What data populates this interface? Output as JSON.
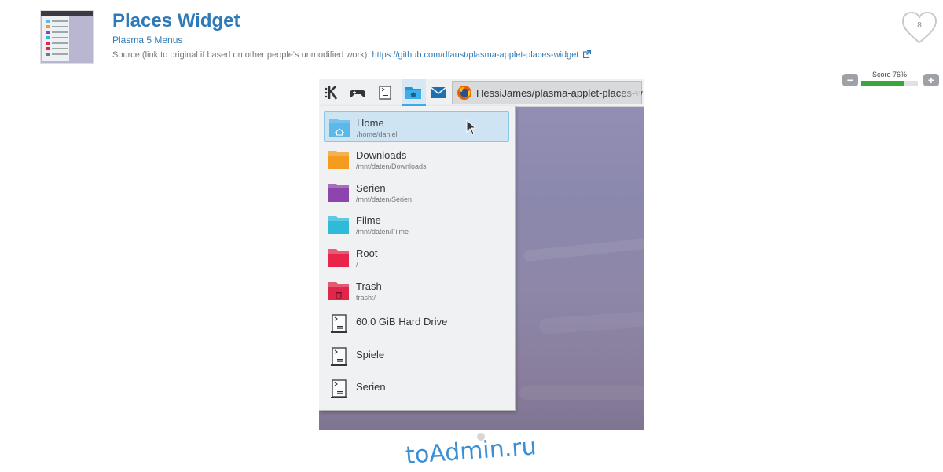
{
  "product": {
    "title": "Places Widget",
    "category": "Plasma 5 Menus",
    "source_prefix": "Source (link to original if based on other people's unmodified work):",
    "source_url": "https://github.com/dfaust/plasma-applet-places-widget",
    "thumbnail_icon": "screenshot-thumbnail"
  },
  "rating": {
    "likes": "8",
    "score_label": "Score 76%",
    "score_percent": 76,
    "minus_label": "−",
    "plus_label": "+"
  },
  "taskbar": {
    "icons": [
      "kde-launcher-icon",
      "gamepad-icon",
      "drive-icon",
      "folder-places-icon",
      "mail-icon",
      "firefox-icon"
    ],
    "firefox_title": "HessiJames/plasma-applet-places-w"
  },
  "places": [
    {
      "name": "Home",
      "path": "/home/daniel",
      "icon": "home-folder-icon",
      "color": "#5bb8e8",
      "selected": true
    },
    {
      "name": "Downloads",
      "path": "/mnt/daten/Downloads",
      "icon": "folder-icon",
      "color": "#f59b1f"
    },
    {
      "name": "Serien",
      "path": "/mnt/daten/Serien",
      "icon": "folder-icon",
      "color": "#8e44ad"
    },
    {
      "name": "Filme",
      "path": "/mnt/daten/Filme",
      "icon": "folder-icon",
      "color": "#2dbbd9"
    },
    {
      "name": "Root",
      "path": "/",
      "icon": "folder-icon",
      "color": "#e8264b"
    },
    {
      "name": "Trash",
      "path": "trash:/",
      "icon": "trash-folder-icon",
      "color": "#e0264a"
    },
    {
      "name": "60,0 GiB Hard Drive",
      "path": "",
      "icon": "hard-drive-icon"
    },
    {
      "name": "Spiele",
      "path": "",
      "icon": "hard-drive-icon"
    },
    {
      "name": "Serien",
      "path": "",
      "icon": "hard-drive-icon"
    }
  ],
  "watermark": "toAdmin.ru",
  "colors": {
    "accent": "#2e7ab8",
    "score_fill": "#3aa53a",
    "selection_bg": "#cfe4f2"
  }
}
